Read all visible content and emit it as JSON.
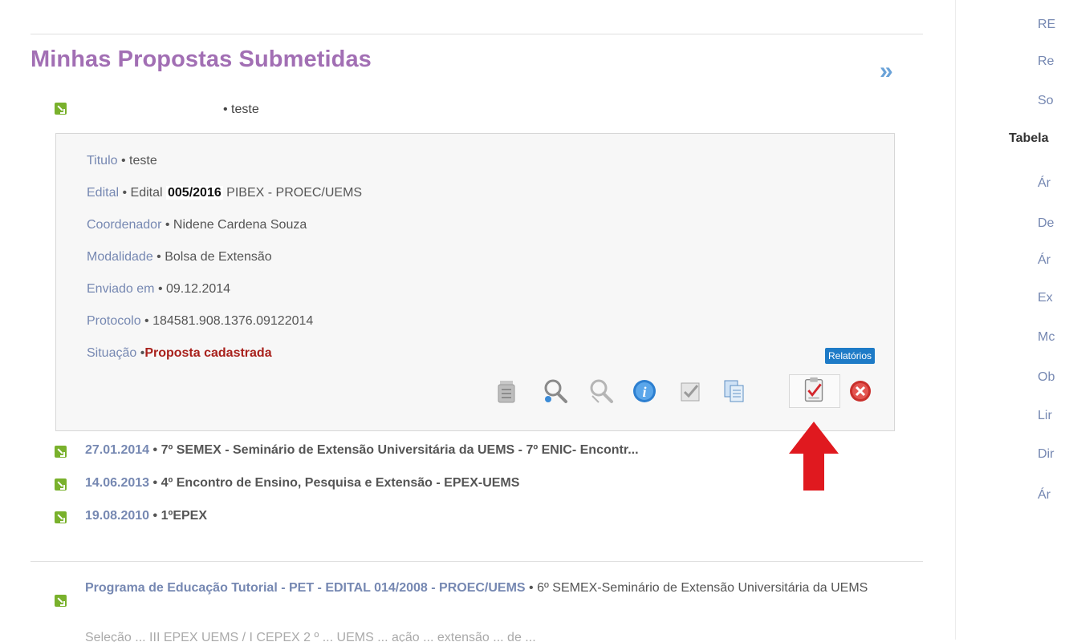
{
  "main": {
    "section_title": "Minhas Propostas Submetidas",
    "more_arrows": "»",
    "proposal_header": "• teste",
    "details": {
      "titulo": {
        "label": "Titulo",
        "sep": " • ",
        "value": "teste"
      },
      "edital": {
        "label": "Edital",
        "sep": " • ",
        "value_pre": "Edital ",
        "value_bold": "005/2016",
        "value_post": " PIBEX - PROEC/UEMS"
      },
      "coordenador": {
        "label": "Coordenador",
        "sep": " • ",
        "value": "Nidene Cardena Souza"
      },
      "modalidade": {
        "label": "Modalidade",
        "sep": " • ",
        "value": "Bolsa de Extensão"
      },
      "enviado": {
        "label": "Enviado em",
        "sep": " • ",
        "value": "09.12.2014"
      },
      "protocolo": {
        "label": "Protocolo",
        "sep": " • ",
        "value": "184581.908.1376.09122014"
      },
      "situacao": {
        "label": "Situação",
        "sep": " •",
        "value": "Proposta cadastrada"
      }
    },
    "toolbar": {
      "tooltip": "Relatórios",
      "icons": [
        "print-icon",
        "view-icon",
        "search-disabled-icon",
        "info-icon",
        "checkbox-icon",
        "copy-icon",
        "reports-icon",
        "delete-icon"
      ]
    },
    "events": [
      {
        "date": "27.01.2014",
        "rest": " • 7º SEMEX - Seminário de Extensão Universitária da UEMS - 7º ENIC- Encontr..."
      },
      {
        "date": "14.06.2013",
        "rest": " • 4º Encontro de Ensino, Pesquisa e Extensão - EPEX-UEMS"
      },
      {
        "date": "19.08.2010",
        "rest": " • 1ºEPEX"
      }
    ],
    "program": {
      "link": "Programa de Educação Tutorial - PET - EDITAL 014/2008 - PROEC/UEMS",
      "rest": " • 6º SEMEX-Seminário de Extensão Universitária da UEMS"
    },
    "cutoff_text": "Seleção ... III EPEX UEMS / I CEPEX 2 º ... UEMS ... ação ... extensão ... de ..."
  },
  "sidebar": {
    "links_top": [
      "RE",
      "Re",
      "So"
    ],
    "heading": "Tabela",
    "links": [
      "Ár",
      "De",
      "Ár",
      "Ex",
      "Mc",
      "Ob",
      "Lir",
      "Dir",
      "Ár"
    ]
  },
  "colors": {
    "title": "#a26fb4",
    "label": "#7688b2",
    "status": "#a8201b",
    "bullet": "#79b12c",
    "tooltip": "#1e7bc7",
    "arrow": "#e0191f"
  }
}
